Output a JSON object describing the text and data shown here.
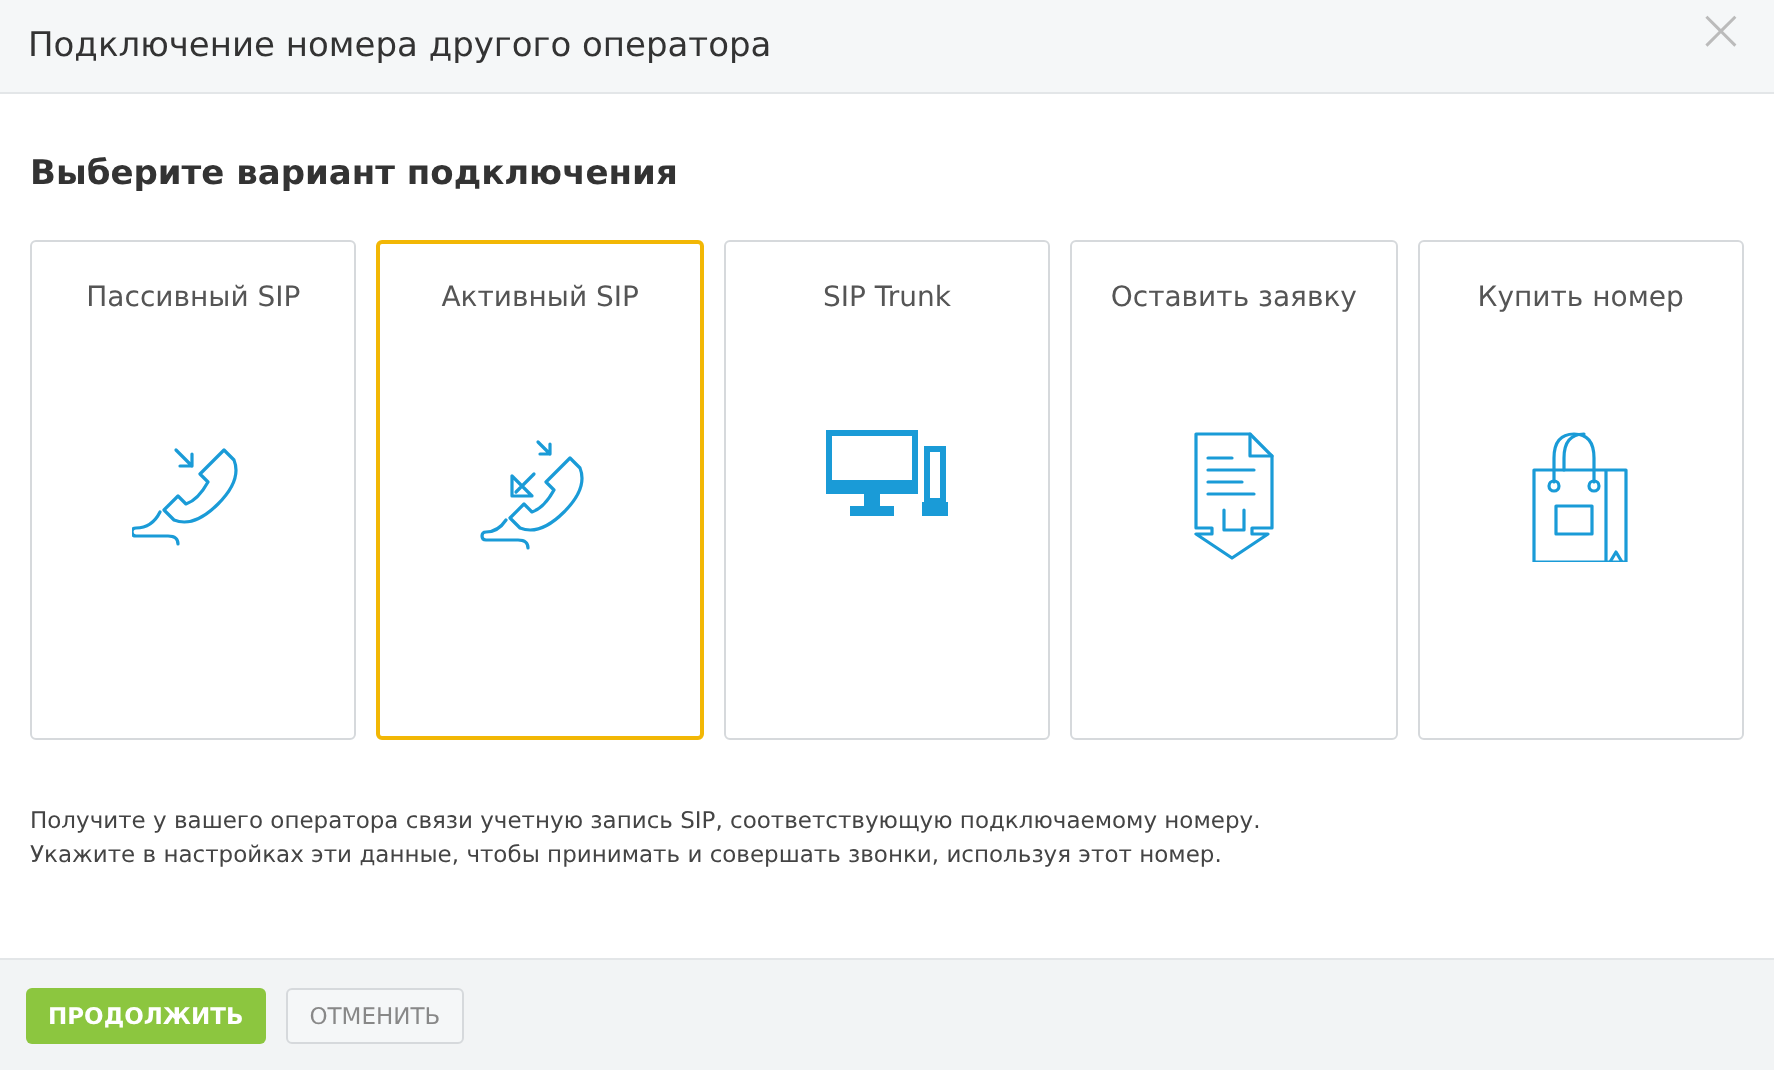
{
  "window": {
    "title": "Подключение номера другого оператора",
    "close": "×"
  },
  "heading": "Выберите вариант подключения",
  "options": [
    {
      "label": "Пассивный SIP",
      "kind": "incoming-call",
      "selected": false
    },
    {
      "label": "Активный SIP",
      "kind": "two-way-call",
      "selected": true
    },
    {
      "label": "SIP Trunk",
      "kind": "computer",
      "selected": false
    },
    {
      "label": "Оставить заявку",
      "kind": "document",
      "selected": false
    },
    {
      "label": "Купить номер",
      "kind": "bag",
      "selected": false
    }
  ],
  "description": [
    "Получите у вашего оператора связи учетную запись SIP, соответствующую подключаемому номеру.",
    "Укажите в настройках эти данные, чтобы принимать и совершать звонки, используя этот номер."
  ],
  "buttons": [
    {
      "label": "ПРОДОЛЖИТЬ",
      "kind": "primary"
    },
    {
      "label": "ОТМЕНИТЬ",
      "kind": "secondary"
    }
  ]
}
